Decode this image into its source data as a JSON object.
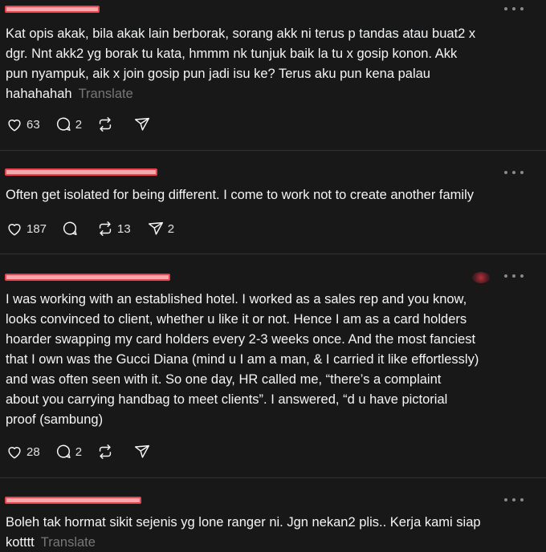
{
  "posts": [
    {
      "text": "Kat opis akak, bila akak lain berborak, sorang akk ni terus p tandas atau buat2 x\ndgr. Nnt akk2 yg borak tu kata, hmmm nk tunjuk baik la tu x gosip konon. Akk\npun nyampuk, aik x join gosip pun jadi isu ke? Terus aku pun kena palau\nhahahahah",
      "translate": "Translate",
      "likes": "63",
      "replies": "2",
      "reposts": "",
      "shares": ""
    },
    {
      "text": "Often get isolated for being different. I come to work not to create another family",
      "translate": "",
      "likes": "187",
      "replies": "",
      "reposts": "13",
      "shares": "2"
    },
    {
      "text": "I was working with an established hotel. I worked as a sales rep and you know,\nlooks convinced to client, whether u like it or not. Hence I am as a card holders\nhoarder swapping my card holders every 2-3 weeks once. And the most fanciest\nthat I own was the Gucci Diana (mind u I am a man, & I carried it like effortlessly)\nand was often seen with it. So one day, HR called me, “there’s a complaint\nabout you carrying handbag to meet clients”. I answered, “d u have pictorial\nproof (sambung)",
      "translate": "",
      "likes": "28",
      "replies": "2",
      "reposts": "",
      "shares": ""
    },
    {
      "text": "Boleh tak hormat sikit sejenis yg lone ranger ni. Jgn nekan2 plis.. Kerja kami siap\nkotttt",
      "translate": "Translate",
      "likes": "",
      "replies": "",
      "reposts": "",
      "shares": ""
    }
  ],
  "icons": {
    "like": "heart-icon",
    "reply": "comment-icon",
    "repost": "repost-icon",
    "share": "send-icon",
    "more": "more-dots-icon"
  },
  "colors": {
    "background": "#181818",
    "text": "#f3f5f7",
    "muted": "#777777",
    "divider": "#323232",
    "redaction": "#e9444e"
  }
}
